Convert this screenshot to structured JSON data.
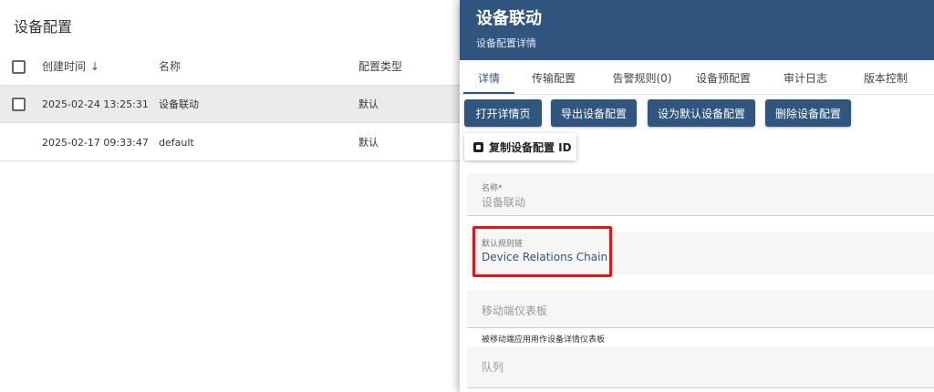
{
  "list": {
    "title": "设备配置",
    "columns": {
      "created": "创建时间",
      "name": "名称",
      "type": "配置类型"
    },
    "sort_icon": "arrow-down-icon",
    "rows": [
      {
        "created": "2025-02-24 13:25:31",
        "name": "设备联动",
        "type": "默认",
        "selected": true
      },
      {
        "created": "2025-02-17 09:33:47",
        "name": "default",
        "type": "默认",
        "selected": false
      }
    ]
  },
  "detail": {
    "title": "设备联动",
    "subtitle": "设备配置详情",
    "header_color": "#305680",
    "tabs": [
      "详情",
      "传输配置",
      "告警规则(0)",
      "设备预配置",
      "审计日志",
      "版本控制"
    ],
    "active_tab": 0,
    "buttons": {
      "open": "打开详情页",
      "export": "导出设备配置",
      "set_default": "设为默认设备配置",
      "delete": "删除设备配置",
      "copy_id": "复制设备配置 ID"
    },
    "fields": {
      "name_label": "名称*",
      "name_value": "设备联动",
      "rule_chain_label": "默认规则链",
      "rule_chain_value": "Device Relations Chain",
      "mobile_dashboard_placeholder": "移动端仪表板",
      "mobile_dashboard_hint": "被移动端应用用作设备详情仪表板",
      "queue_placeholder": "队列"
    },
    "highlight_color": "#e3131b"
  }
}
